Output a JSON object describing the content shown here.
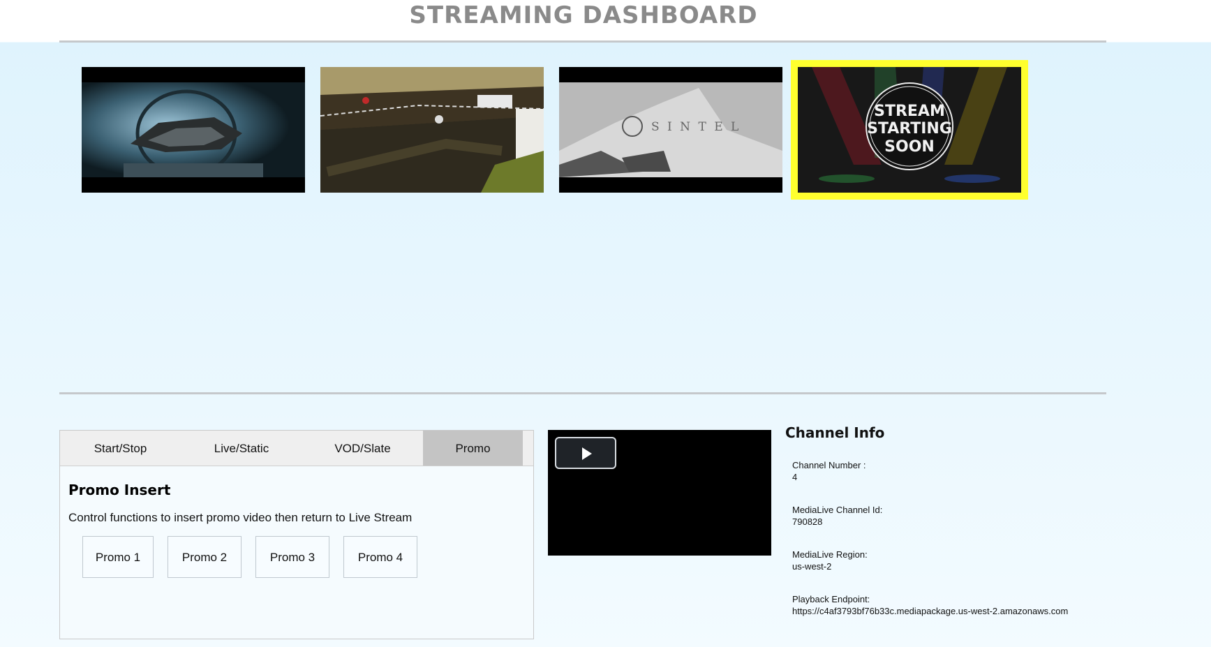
{
  "header": {
    "title": "STREAMING DASHBOARD"
  },
  "thumbnails": [
    {
      "name": "spaceship-scene",
      "selected": false
    },
    {
      "name": "motocross-scene",
      "selected": false
    },
    {
      "name": "sintel-scene",
      "selected": false,
      "overlay_text": "S I N T E L"
    },
    {
      "name": "stream-starting-soon",
      "selected": true,
      "overlay_lines": [
        "STREAM",
        "STARTING",
        "SOON"
      ],
      "highlight_color": "#ffff2e"
    }
  ],
  "tabs": [
    {
      "label": "Start/Stop",
      "active": false
    },
    {
      "label": "Live/Static",
      "active": false
    },
    {
      "label": "VOD/Slate",
      "active": false
    },
    {
      "label": "Promo",
      "active": true
    }
  ],
  "promo": {
    "title": "Promo Insert",
    "description": "Control functions to insert promo video then return to Live Stream",
    "buttons": [
      "Promo 1",
      "Promo 2",
      "Promo 3",
      "Promo 4"
    ]
  },
  "player": {
    "play_icon": "play-icon"
  },
  "channel_info": {
    "title": "Channel Info",
    "items": [
      {
        "label": "Channel Number :",
        "value": "4"
      },
      {
        "label": "MediaLive Channel Id:",
        "value": "790828"
      },
      {
        "label": "MediaLive Region:",
        "value": "us-west-2"
      },
      {
        "label": "Playback Endpoint:",
        "value": "https://c4af3793bf76b33c.mediapackage.us-west-2.amazonaws.com"
      }
    ]
  }
}
